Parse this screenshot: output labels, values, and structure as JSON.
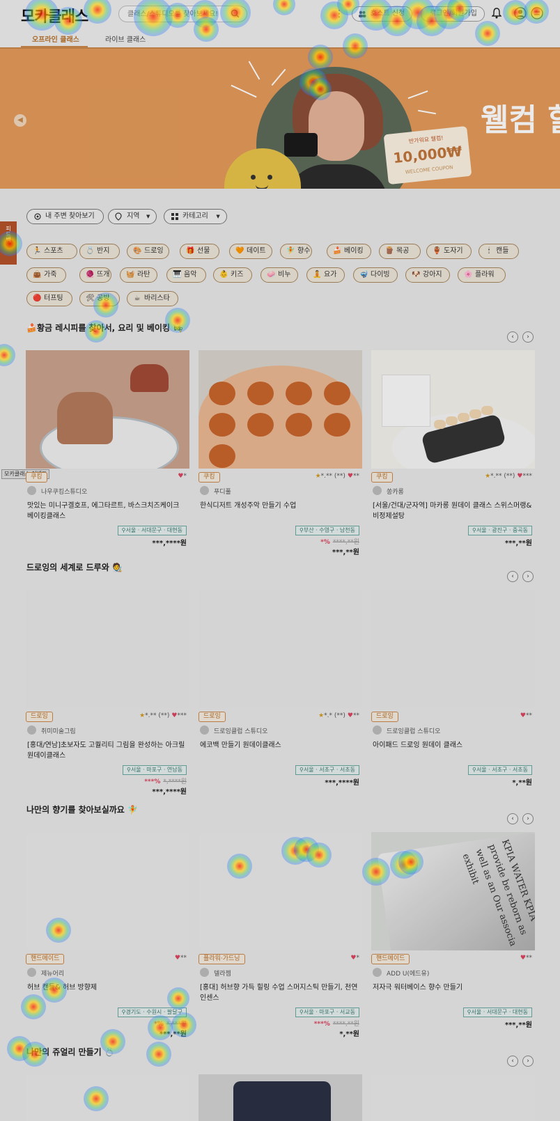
{
  "header": {
    "logo": "모카클래스",
    "search_placeholder": "클래스/스튜디오를 찾아보세요!",
    "btn_host": "호스트 신청",
    "btn_login": "로그인/회원가입",
    "tabs": [
      "오프라인 클래스",
      "라이브 클래스"
    ]
  },
  "banner": {
    "coupon_top": "반가워요 웰컴!",
    "coupon_amount": "10,000₩",
    "coupon_bottom": "WELCOME COUPON",
    "headline": "웰컴 할인"
  },
  "filters": [
    "내 주변 찾아보기",
    "지역",
    "카테고리"
  ],
  "categories": [
    {
      "label": "스포츠",
      "icon": "🏃"
    },
    {
      "label": "반지",
      "icon": "💍"
    },
    {
      "label": "드로잉",
      "icon": "🎨"
    },
    {
      "label": "선물",
      "icon": "🎁"
    },
    {
      "label": "데이트",
      "icon": "🧡"
    },
    {
      "label": "향수",
      "icon": "🧚"
    },
    {
      "label": "베이킹",
      "icon": "🍰"
    },
    {
      "label": "목공",
      "icon": "🪵"
    },
    {
      "label": "도자기",
      "icon": "🏺"
    },
    {
      "label": "캔들",
      "icon": "🕯"
    },
    {
      "label": "가죽",
      "icon": "👜"
    },
    {
      "label": "뜨개",
      "icon": "🧶"
    },
    {
      "label": "라탄",
      "icon": "🧺"
    },
    {
      "label": "음악",
      "icon": "🎹"
    },
    {
      "label": "키즈",
      "icon": "👶"
    },
    {
      "label": "비누",
      "icon": "🧼"
    },
    {
      "label": "요가",
      "icon": "🧘"
    },
    {
      "label": "다이빙",
      "icon": "🤿"
    },
    {
      "label": "강아지",
      "icon": "🐶"
    },
    {
      "label": "플라워",
      "icon": "🌸"
    },
    {
      "label": "터프팅",
      "icon": "🔴"
    },
    {
      "label": "공방",
      "icon": "🛠"
    },
    {
      "label": "바리스타",
      "icon": "☕"
    }
  ],
  "side": {
    "tab": "피드백",
    "label": "모카클래스 이벤트"
  },
  "sections": [
    {
      "title": "🍰황금 레시피를 찾아서, 요리 및 베이킹 👩‍🍳",
      "cards": [
        {
          "badge": "쿠킹",
          "studio": "나우쿠킹스튜디오",
          "title": "맛있는 미니구겔호프, 에그타르트, 바스크치즈케이크 베이킹클래스",
          "loc": "서울 · 서대문구 · 대현동",
          "rating": "",
          "likes": "*",
          "disc": "",
          "orig": "",
          "price": "***,****원"
        },
        {
          "badge": "쿠킹",
          "studio": "푸디풀",
          "title": "한식디저트 개성주악 만들기 수업",
          "loc": "부산 · 수영구 · 남천동",
          "rating": "*.** (**)",
          "likes": "**",
          "disc": "*%",
          "orig": "****,**원",
          "price": "***,**원"
        },
        {
          "badge": "쿠킹",
          "studio": "쏭카롱",
          "title": "[서울/건대/군자역] 마카롱 원데이 클래스 스위스머랭&비정제설탕",
          "loc": "서울 · 광진구 · 중곡동",
          "rating": "*.** (**)",
          "likes": "***",
          "disc": "",
          "orig": "",
          "price": "***,**원"
        }
      ]
    },
    {
      "title": "드로잉의 세계로 드루와 🧑‍🎨",
      "cards": [
        {
          "badge": "드로잉",
          "studio": "취미미술그림",
          "title": "[홍대/연남]초보자도 고퀄리티 그림을 완성하는 아크릴 원데이클래스",
          "loc": "서울 · 마포구 · 연남동",
          "rating": "*.** (**)",
          "likes": "***",
          "disc": "***%",
          "orig": "*,****원",
          "price": "***,****원"
        },
        {
          "badge": "드로잉",
          "studio": "드로잉클럽 스튜디오",
          "title": "에코백 만들기 원데이클래스",
          "loc": "서울 · 서초구 · 서초동",
          "rating": "*.* (**)",
          "likes": "**",
          "disc": "",
          "orig": "",
          "price": "***,****원"
        },
        {
          "badge": "드로잉",
          "studio": "드로잉클럽 스튜디오",
          "title": "아이패드 드로잉 원데이 클래스",
          "loc": "서울 · 서초구 · 서초동",
          "rating": "",
          "likes": "**",
          "disc": "",
          "orig": "",
          "price": "*,**원"
        }
      ]
    },
    {
      "title": "나만의 향기를 찾아보실까요 🧚",
      "cards": [
        {
          "badge": "핸드메이드",
          "studio": "제뉴어리",
          "title": "허브 캔들& 허브 방향제",
          "loc": "경기도 · 수원시 · 팔달구",
          "rating": "",
          "likes": "**",
          "disc": "*%",
          "orig": "*,***원",
          "price": "***,**원"
        },
        {
          "badge": "플라워·가드닝",
          "studio": "델라젬",
          "title": "[홍대] 허브향 가득 힐링 수업 스머지스틱 만들기, 천연인센스",
          "loc": "서울 · 마포구 · 서교동",
          "rating": "",
          "likes": "*",
          "disc": "***%",
          "orig": "****,**원",
          "price": "*,**원"
        },
        {
          "badge": "핸드메이드",
          "studio": "ADD U(에드유)",
          "title": "저자극 워터베이스 향수 만들기",
          "loc": "서울 · 서대문구 · 대현동",
          "rating": "",
          "likes": "**",
          "disc": "",
          "orig": "",
          "price": "***,**원"
        }
      ]
    },
    {
      "title": "나만의 쥬얼리 만들기 💍",
      "cards": []
    }
  ],
  "bottle_text": "KPIA WATER KPIA provide be reborn as well as an Our associa exhibit"
}
